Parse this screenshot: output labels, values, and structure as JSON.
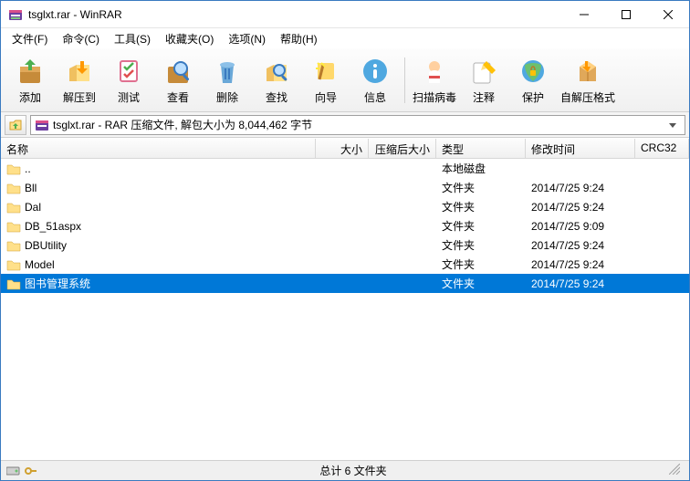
{
  "window": {
    "title": "tsglxt.rar - WinRAR"
  },
  "menus": {
    "file": "文件(F)",
    "commands": "命令(C)",
    "tools": "工具(S)",
    "favorites": "收藏夹(O)",
    "options": "选项(N)",
    "help": "帮助(H)"
  },
  "toolbar": {
    "add": "添加",
    "extract": "解压到",
    "test": "测试",
    "view": "查看",
    "delete": "删除",
    "find": "查找",
    "wizard": "向导",
    "info": "信息",
    "scan": "扫描病毒",
    "comment": "注释",
    "protect": "保护",
    "sfx": "自解压格式"
  },
  "path": {
    "text": "tsglxt.rar - RAR 压缩文件, 解包大小为 8,044,462 字节"
  },
  "columns": {
    "name": "名称",
    "size": "大小",
    "packed": "压缩后大小",
    "type": "类型",
    "modified": "修改时间",
    "crc": "CRC32"
  },
  "rows": [
    {
      "name": "..",
      "type": "本地磁盘",
      "modified": "",
      "selected": false,
      "up": true
    },
    {
      "name": "Bll",
      "type": "文件夹",
      "modified": "2014/7/25 9:24",
      "selected": false
    },
    {
      "name": "Dal",
      "type": "文件夹",
      "modified": "2014/7/25 9:24",
      "selected": false
    },
    {
      "name": "DB_51aspx",
      "type": "文件夹",
      "modified": "2014/7/25 9:09",
      "selected": false
    },
    {
      "name": "DBUtility",
      "type": "文件夹",
      "modified": "2014/7/25 9:24",
      "selected": false
    },
    {
      "name": "Model",
      "type": "文件夹",
      "modified": "2014/7/25 9:24",
      "selected": false
    },
    {
      "name": "图书管理系统",
      "type": "文件夹",
      "modified": "2014/7/25 9:24",
      "selected": true
    }
  ],
  "status": {
    "summary": "总计 6 文件夹"
  }
}
